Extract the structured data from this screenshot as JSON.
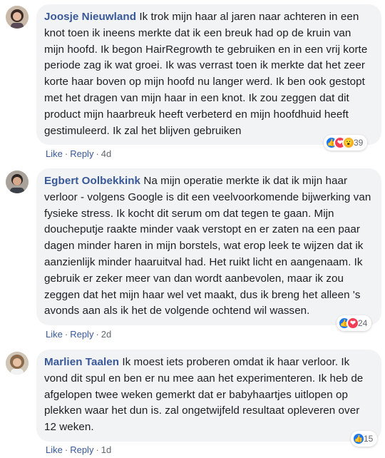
{
  "comments": [
    {
      "author": "Joosje Nieuwland",
      "text": "Ik trok mijn haar al jaren naar achteren in een knot toen ik ineens merkte dat ik een breuk had op de kruin van mijn hoofd. Ik begon HairRegrowth te gebruiken en in een vrij korte periode zag ik wat groei. Ik was verrast toen ik merkte dat het zeer korte haar boven op mijn hoofd nu langer werd. Ik ben ook gestopt met het dragen van mijn haar in een knot. Ik zou zeggen dat dit product mijn haarbreuk heeft verbeterd en mijn hoofdhuid heeft gestimuleerd. Ik zal het blijven gebruiken",
      "reactions": [
        "like",
        "love",
        "wow"
      ],
      "reaction_count": "39",
      "like_label": "Like",
      "reply_label": "Reply",
      "time": "4d"
    },
    {
      "author": "Egbert Oolbekkink",
      "text": "Na mijn operatie merkte ik dat ik mijn haar verloor - volgens Google is dit een veelvoorkomende bijwerking van fysieke stress. Ik kocht dit serum om dat tegen te gaan. Mijn doucheputje raakte minder vaak verstopt en er zaten na een paar dagen minder haren in mijn borstels, wat erop leek te wijzen dat ik aanzienlijk minder haaruitval had. Het ruikt licht en aangenaam. Ik gebruik er zeker meer van dan wordt aanbevolen, maar ik zou zeggen dat het mijn haar wel vet maakt, dus ik breng het alleen 's avonds aan als ik het de volgende ochtend wil wassen.",
      "reactions": [
        "like",
        "love"
      ],
      "reaction_count": "24",
      "like_label": "Like",
      "reply_label": "Reply",
      "time": "2d"
    },
    {
      "author": "Marlien Taalen",
      "text": "Ik moest iets proberen omdat ik haar verloor. Ik vond dit spul en ben er nu mee aan het experimenteren. Ik heb de afgelopen twee weken gemerkt dat er babyhaartjes uitlopen op plekken waar het dun is. zal ongetwijfeld resultaat opleveren over 12 weken.",
      "reactions": [
        "like"
      ],
      "reaction_count": "15",
      "like_label": "Like",
      "reply_label": "Reply",
      "time": "1d"
    }
  ],
  "colors": {
    "author_link": "#385898",
    "bubble_bg": "#f2f3f5",
    "like_blue": "#1877f2",
    "love_red": "#f33e58",
    "wow_yellow": "#f7b125"
  }
}
